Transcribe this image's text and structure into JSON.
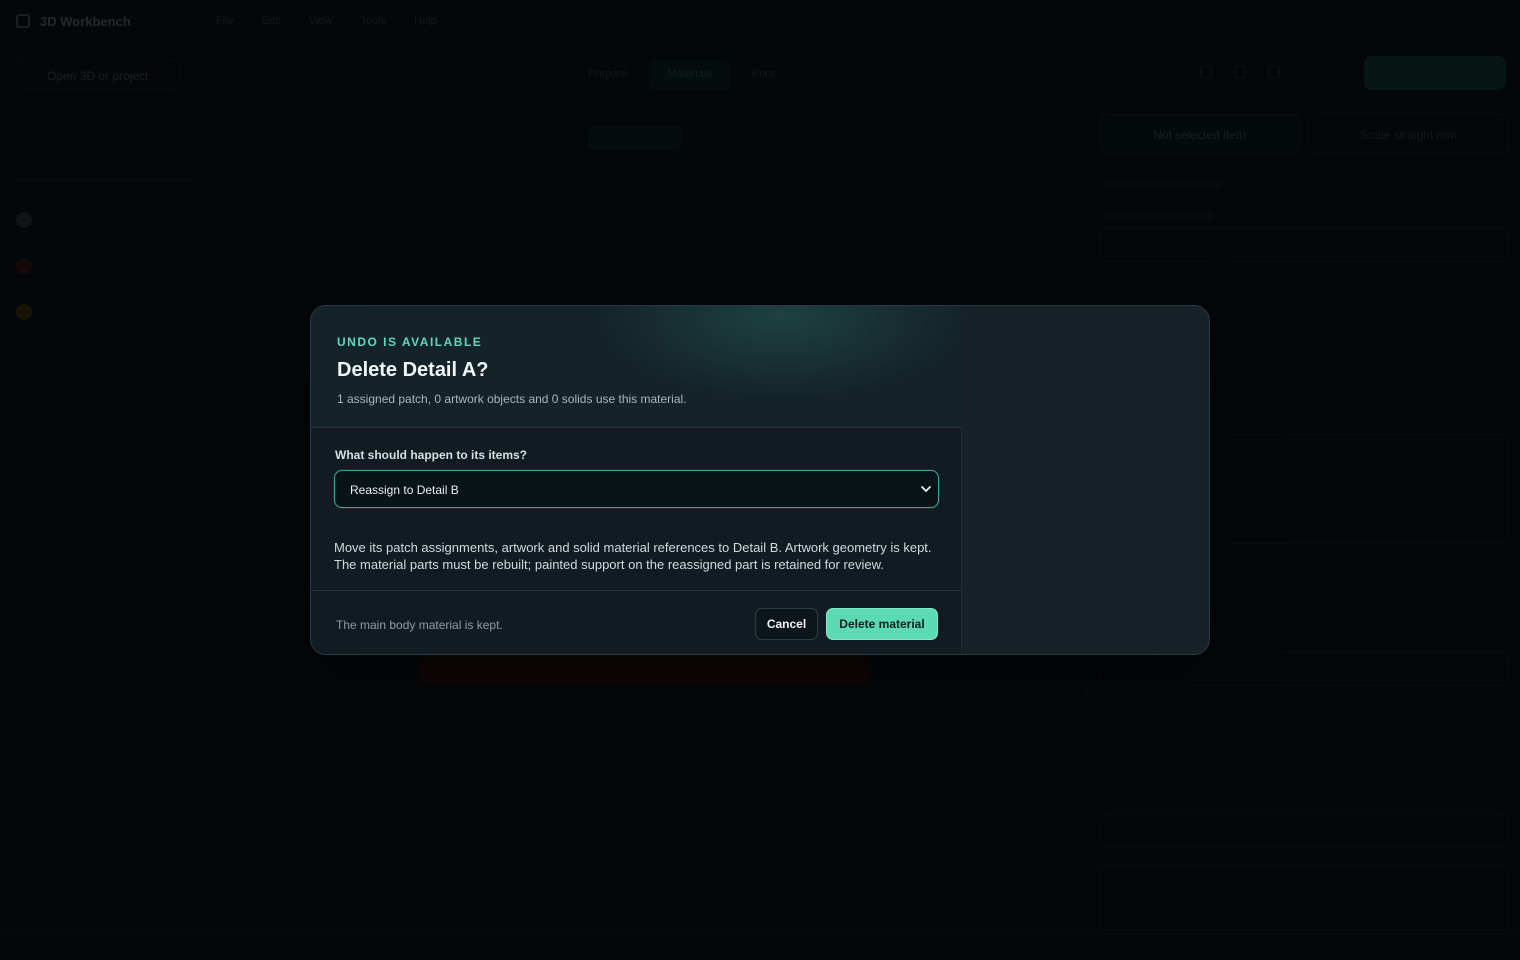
{
  "background": {
    "app_name": "3D Workbench",
    "menu": [
      "File",
      "Edit",
      "View",
      "Tools",
      "Help"
    ],
    "project_button": "Open 3D or project",
    "mode_tabs": [
      "Prepare",
      "Materials",
      "Print"
    ],
    "left_panel": {
      "materials": [
        {
          "color": "#9aa4a8"
        },
        {
          "color": "#b2322e"
        },
        {
          "color": "#d6a324"
        }
      ]
    },
    "right_panel": {
      "tabs": [
        "Not selected item",
        "Scale straight mm"
      ]
    }
  },
  "dialog": {
    "eyebrow": "UNDO IS AVAILABLE",
    "title": "Delete Detail A?",
    "subtitle": "1 assigned patch, 0 artwork objects and 0 solids use this material.",
    "field_label": "What should happen to its items?",
    "select_value": "Reassign to Detail B",
    "explanation": "Move its patch assignments, artwork and solid material references to Detail B. Artwork geometry is kept. The material parts must be rebuilt; painted support on the reassigned part is retained for review.",
    "footer_note": "The main body material is kept.",
    "cancel_label": "Cancel",
    "confirm_label": "Delete material"
  },
  "colors": {
    "accent": "#5cdbb2",
    "eyebrow": "#5fd8b5",
    "danger_bar": "#3a1612"
  }
}
